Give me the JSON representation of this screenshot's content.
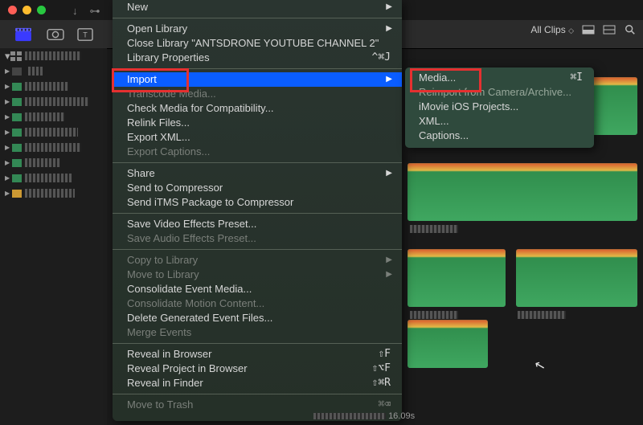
{
  "traffic": {
    "close": "",
    "min": "",
    "max": ""
  },
  "toolbar_right": {
    "allclips": "All Clips",
    "updn": "◇"
  },
  "menu": {
    "new": "New",
    "open_library": "Open Library",
    "close_library": "Close Library \"ANTSDRONE YOUTUBE CHANNEL 2\"",
    "lib_props": "Library Properties",
    "lib_props_sc": "^⌘J",
    "import": "Import",
    "transcode": "Transcode Media...",
    "check_compat": "Check Media for Compatibility...",
    "relink": "Relink Files...",
    "export_xml": "Export XML...",
    "export_captions": "Export Captions...",
    "share": "Share",
    "send_compressor": "Send to Compressor",
    "send_itms": "Send iTMS Package to Compressor",
    "save_vfx": "Save Video Effects Preset...",
    "save_afx": "Save Audio Effects Preset...",
    "copy_lib": "Copy to Library",
    "move_lib": "Move to Library",
    "consolidate_event": "Consolidate Event Media...",
    "consolidate_motion": "Consolidate Motion Content...",
    "delete_gen": "Delete Generated Event Files...",
    "merge_events": "Merge Events",
    "reveal_browser": "Reveal in Browser",
    "reveal_browser_sc": "⇧F",
    "reveal_proj": "Reveal Project in Browser",
    "reveal_proj_sc": "⇧⌥F",
    "reveal_finder": "Reveal in Finder",
    "reveal_finder_sc": "⇧⌘R",
    "move_trash": "Move to Trash",
    "move_trash_sc": "⌘⌫"
  },
  "submenu": {
    "media": "Media...",
    "media_sc": "⌘I",
    "reimport": "Reimport from Camera/Archive...",
    "imovie": "iMovie iOS Projects...",
    "xml": "XML...",
    "captions": "Captions..."
  },
  "status": {
    "tc": "16.09s"
  }
}
